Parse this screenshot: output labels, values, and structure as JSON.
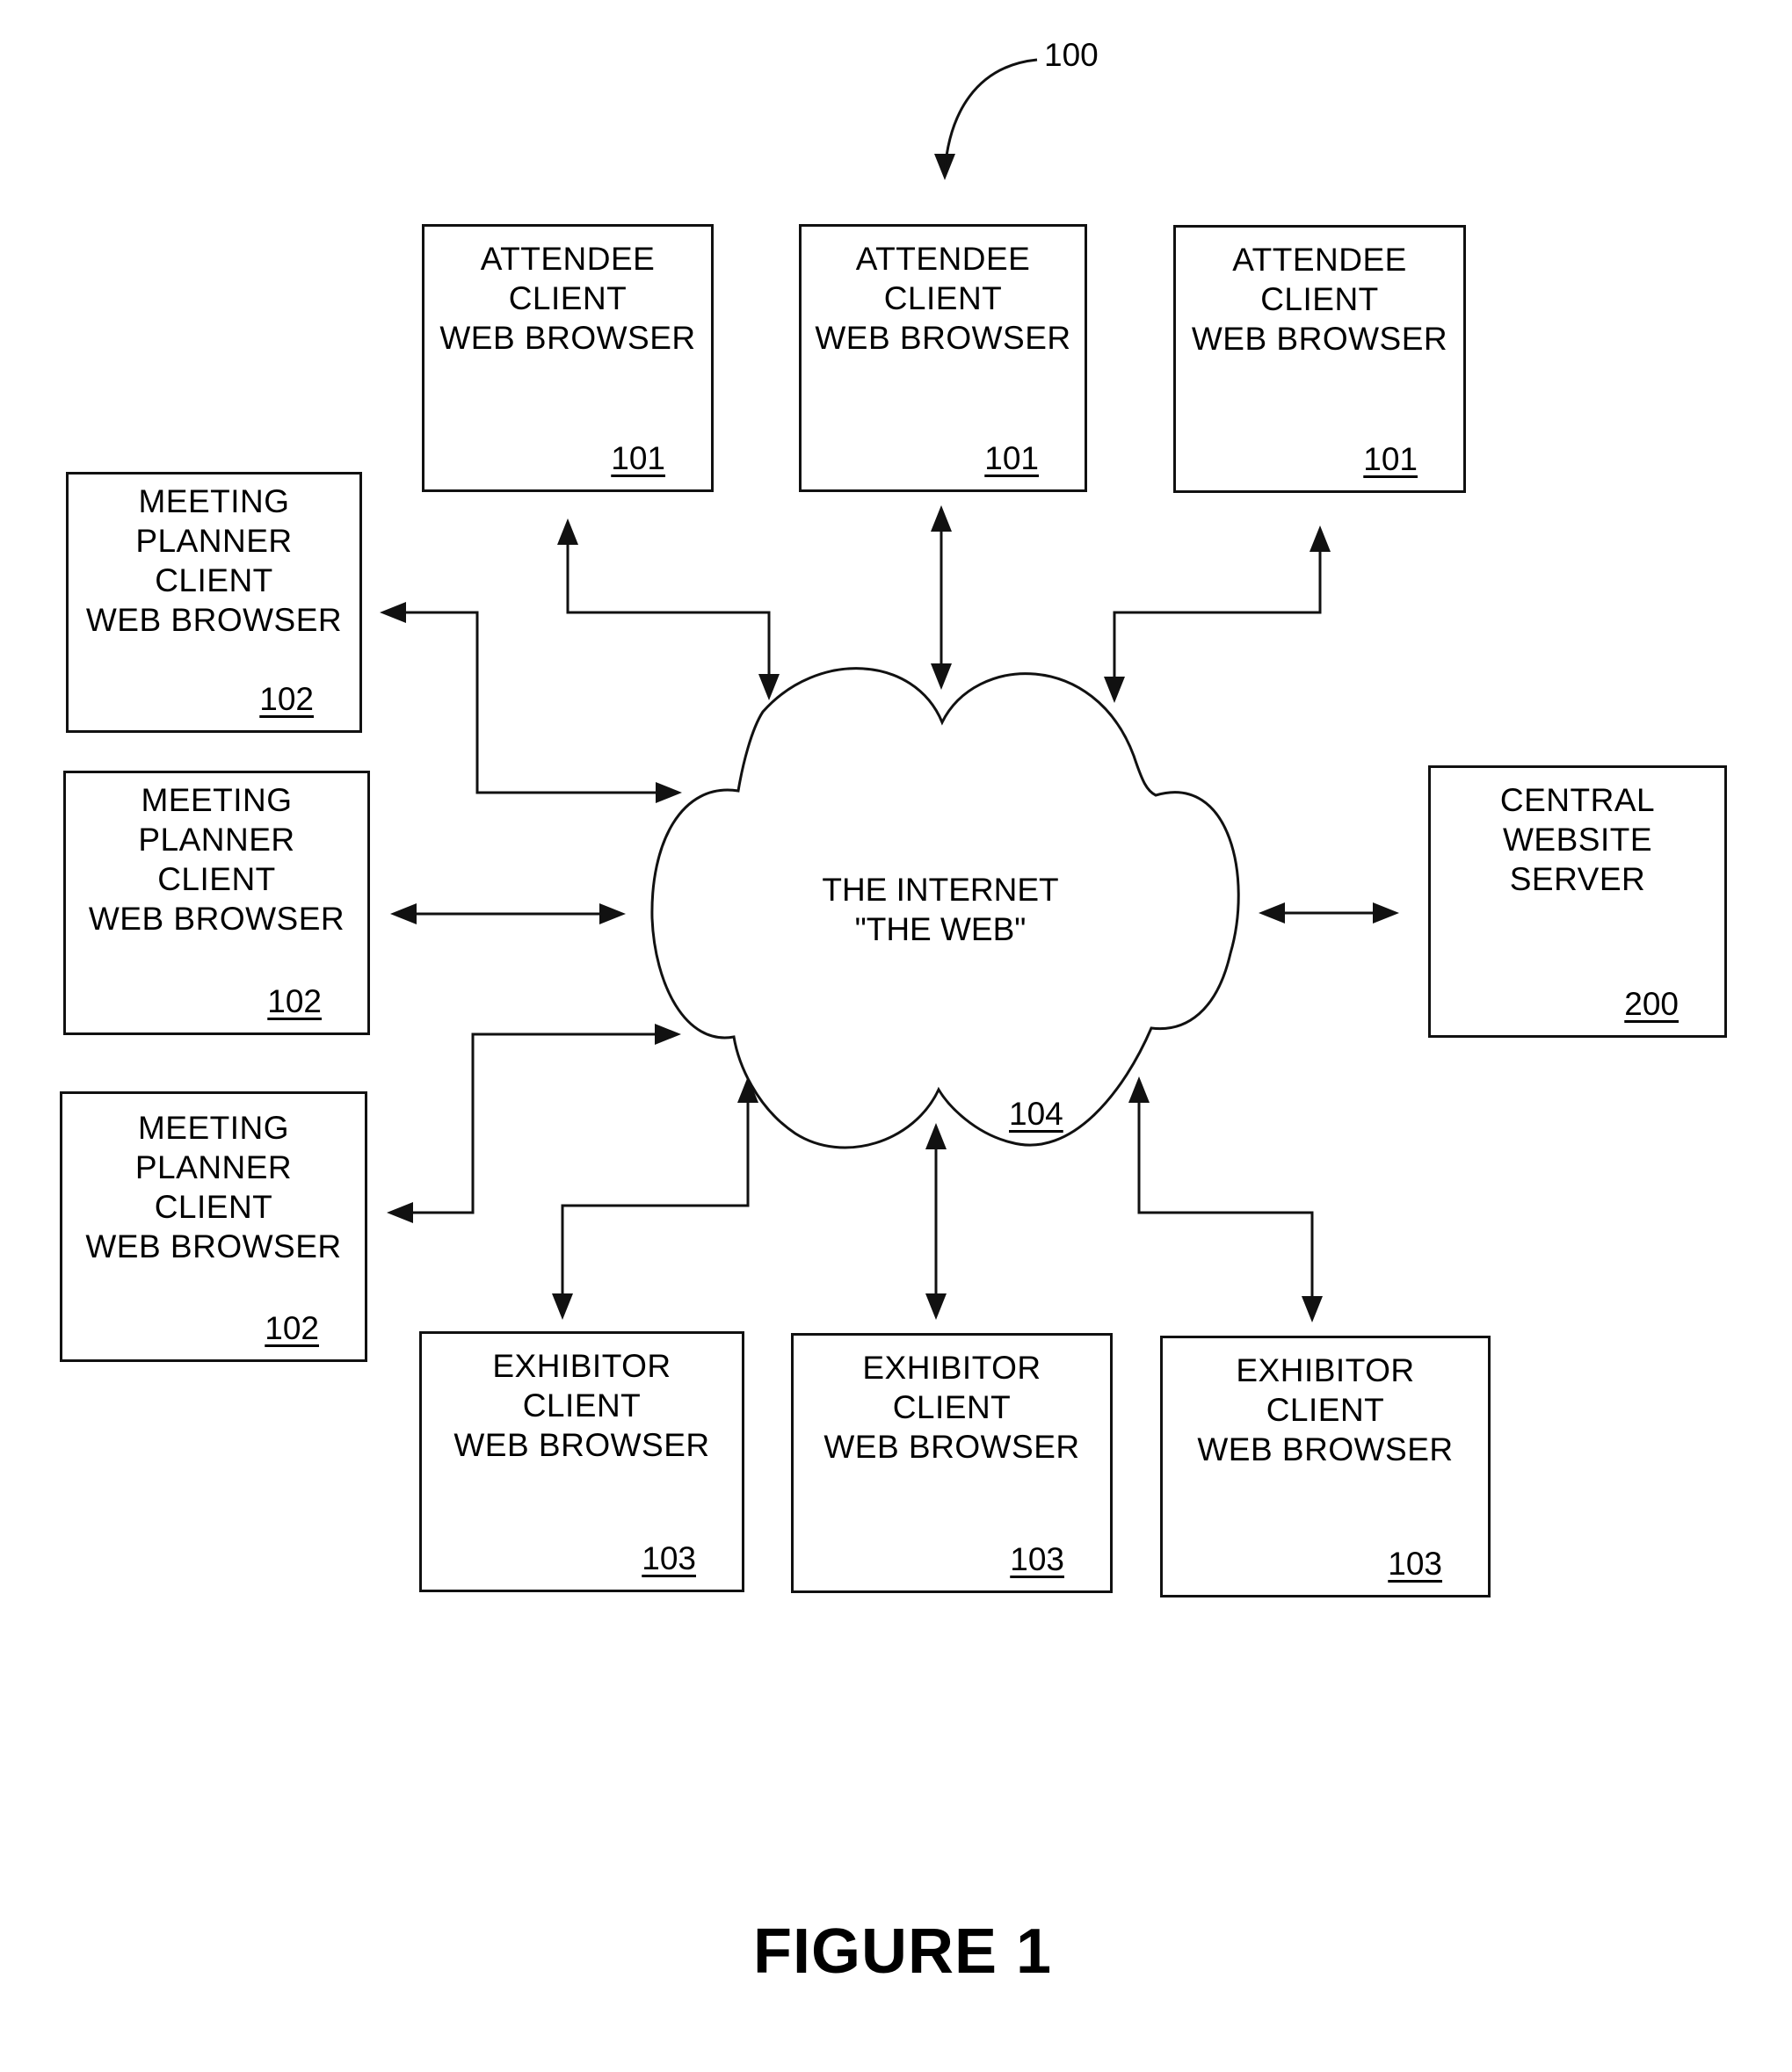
{
  "figure": {
    "caption": "FIGURE 1",
    "system_ref": "100"
  },
  "attendees": [
    {
      "label": "ATTENDEE\nCLIENT\nWEB BROWSER",
      "ref": "101"
    },
    {
      "label": "ATTENDEE\nCLIENT\nWEB BROWSER",
      "ref": "101"
    },
    {
      "label": "ATTENDEE\nCLIENT\nWEB BROWSER",
      "ref": "101"
    }
  ],
  "planners": [
    {
      "label": "MEETING\nPLANNER\nCLIENT\nWEB BROWSER",
      "ref": "102"
    },
    {
      "label": "MEETING\nPLANNER\nCLIENT\nWEB BROWSER",
      "ref": "102"
    },
    {
      "label": "MEETING\nPLANNER\nCLIENT\nWEB BROWSER",
      "ref": "102"
    }
  ],
  "exhibitors": [
    {
      "label": "EXHIBITOR\nCLIENT\nWEB BROWSER",
      "ref": "103"
    },
    {
      "label": "EXHIBITOR\nCLIENT\nWEB BROWSER",
      "ref": "103"
    },
    {
      "label": "EXHIBITOR\nCLIENT\nWEB BROWSER",
      "ref": "103"
    }
  ],
  "internet": {
    "label": "THE INTERNET\n\"THE WEB\"",
    "ref": "104"
  },
  "server": {
    "label": "CENTRAL\nWEBSITE\nSERVER",
    "ref": "200"
  }
}
